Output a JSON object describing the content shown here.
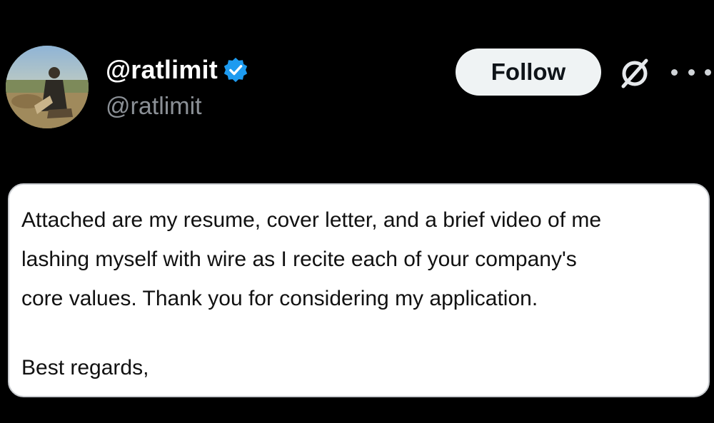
{
  "post": {
    "display_name": "@ratlimit",
    "handle": "@ratlimit",
    "verified": true,
    "follow_label": "Follow",
    "icons": {
      "verified": "verified-badge-icon",
      "grok": "grok-icon",
      "more": "more-options-icon"
    },
    "colors": {
      "background": "#000000",
      "verified_blue": "#1d9bf0",
      "handle_gray": "#8b9096",
      "follow_bg": "#eff3f4"
    },
    "body_lines": [
      "Attached are my resume, cover letter, and a brief video of me",
      "lashing myself with wire as I recite each of your company's",
      "core values. Thank you for considering my application."
    ],
    "closing": "Best regards,"
  }
}
